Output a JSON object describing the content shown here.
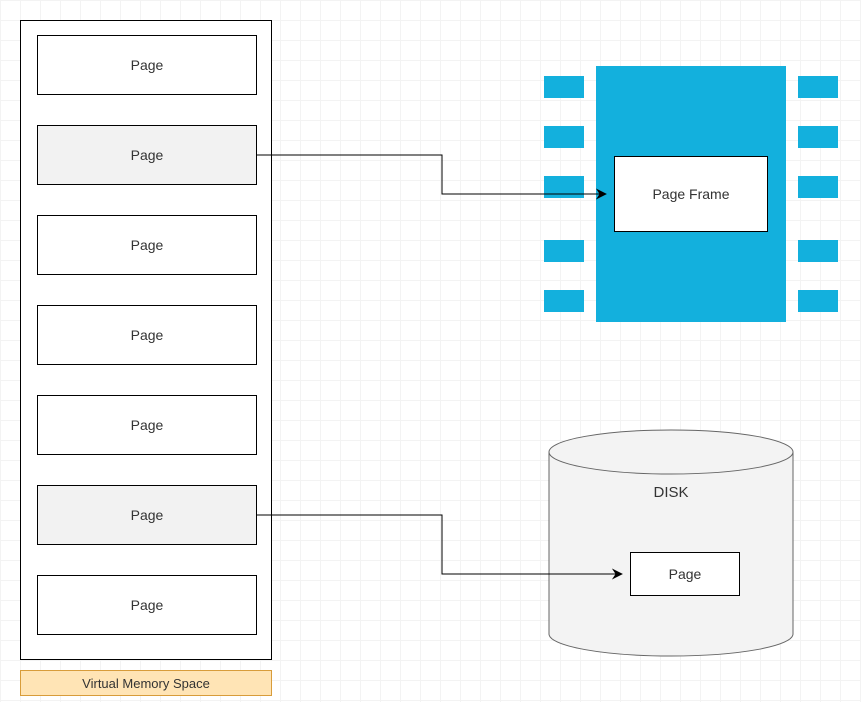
{
  "vm": {
    "label": "Virtual Memory Space",
    "pages": [
      {
        "label": "Page",
        "shaded": false
      },
      {
        "label": "Page",
        "shaded": true
      },
      {
        "label": "Page",
        "shaded": false
      },
      {
        "label": "Page",
        "shaded": false
      },
      {
        "label": "Page",
        "shaded": false
      },
      {
        "label": "Page",
        "shaded": true
      },
      {
        "label": "Page",
        "shaded": false
      }
    ]
  },
  "chip": {
    "frame_label": "Page Frame",
    "body_color": "#13b0dd"
  },
  "disk": {
    "label": "DISK",
    "page_label": "Page",
    "fill": "#f3f3f3",
    "stroke": "#666666"
  }
}
